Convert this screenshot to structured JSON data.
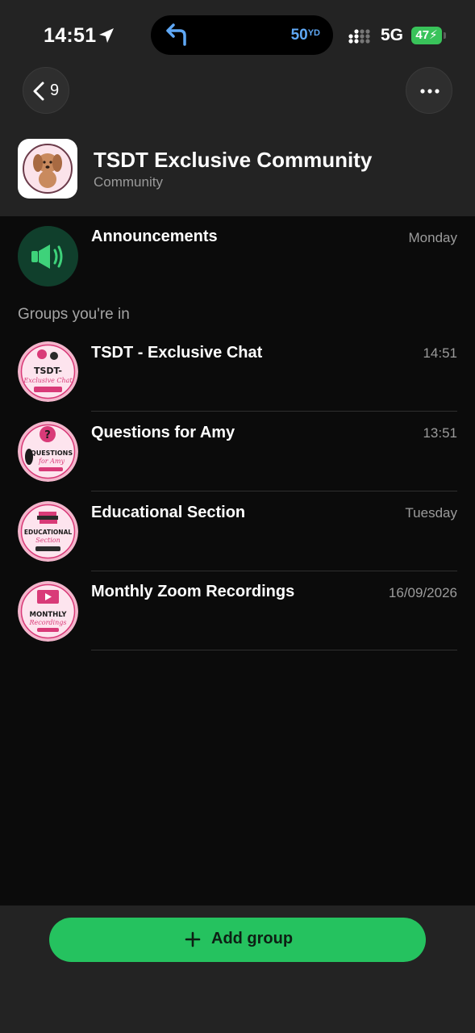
{
  "status_bar": {
    "time": "14:51",
    "island_distance": "50",
    "island_distance_unit": "YD",
    "network": "5G",
    "battery": "47"
  },
  "nav": {
    "back_count": "9"
  },
  "community": {
    "title": "TSDT Exclusive Community",
    "subtitle": "Community"
  },
  "announcements": {
    "title": "Announcements",
    "time": "Monday"
  },
  "groups_section_label": "Groups you're in",
  "groups": [
    {
      "title": "TSDT - Exclusive Chat",
      "time": "14:51",
      "badge_line1": "TSDT-",
      "badge_line2": "Exclusive Chat"
    },
    {
      "title": "Questions for Amy",
      "time": "13:51",
      "badge_line1": "QUESTIONS",
      "badge_line2": "for Amy"
    },
    {
      "title": "Educational Section",
      "time": "Tuesday",
      "badge_line1": "EDUCATIONAL",
      "badge_line2": "Section"
    },
    {
      "title": "Monthly Zoom Recordings",
      "time": "16/09/2026",
      "badge_line1": "MONTHLY",
      "badge_line2": "Recordings"
    }
  ],
  "add_group_label": "Add group",
  "colors": {
    "accent_green": "#25c25f",
    "announce_bg": "#103f2c",
    "announce_icon": "#3ed27a",
    "badge_pink": "#f3b6cc",
    "badge_magenta": "#d93a78",
    "maps_blue": "#5fa8f5",
    "battery_green": "#39c35a"
  },
  "icons": {
    "location": "location-arrow-icon",
    "nav_turn": "turn-left-arrow-icon",
    "signal": "cellular-signal-icon",
    "back": "chevron-left-icon",
    "more": "ellipsis-icon",
    "announce": "megaphone-icon",
    "add": "plus-icon"
  }
}
